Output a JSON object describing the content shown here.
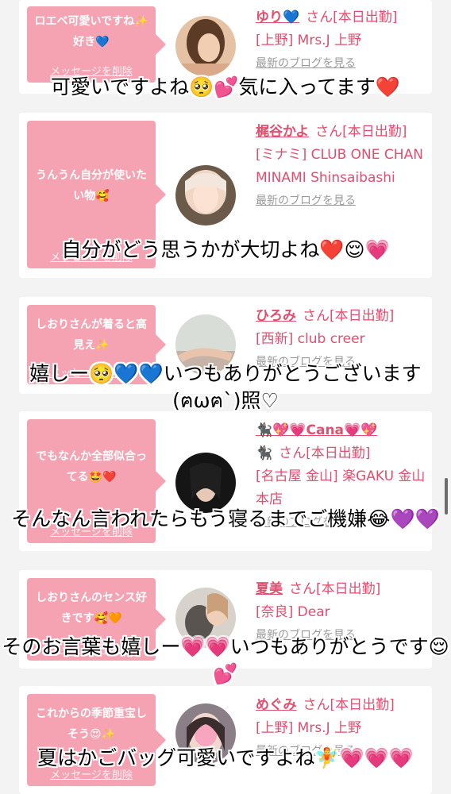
{
  "cards": [
    {
      "message": "ロエベ可愛いですね✨好き💙",
      "delete": "メッセージを削除",
      "name": "ゆり💙",
      "san": "さん[本日出勤]",
      "location": "[上野] Mrs.J 上野",
      "blog": "最新のブログを見る",
      "caption": "可愛いですよね🥺💕気に入ってます❤️"
    },
    {
      "message": "うんうん自分が使いたい物🥰",
      "delete": "メッセージを削除",
      "name": "梶谷かよ",
      "san": "さん[本日出勤]",
      "location": "[ミナミ] CLUB ONE CHAN MINAMI Shinsaibashi",
      "blog": "最新のブログを見る",
      "caption": "自分がどう思うかが大切よね❤️😌💗"
    },
    {
      "message": "しおりさんが着ると高見え✨",
      "delete": "メッセージを削除",
      "name": "ひろみ",
      "san": "さん[本日出勤]",
      "location": "[西新] club creer",
      "blog": "最新のブログを見る",
      "caption": "嬉しー🥺💙💙いつもありがとうございます(ฅωฅ`)照♡"
    },
    {
      "message": "でもなんか全部似合ってる🤩❤️",
      "delete": "メッセージを削除",
      "name": "🐈‍⬛💖💗Cana💗💖",
      "name2": "🐈‍⬛",
      "san": "さん[本日出勤]",
      "location": "[名古屋 金山] 楽GAKU 金山本店",
      "blog": "最新のブログを見る",
      "caption": "そんなん言われたらもう寝るまでご機嫌😂💜💜"
    },
    {
      "message": "しおりさんのセンス好きです🥰🧡",
      "delete": "メッセージを削除",
      "name": "夏美",
      "san": "さん[本日出勤]",
      "location": "[奈良] Dear",
      "blog": "最新のブログを見る",
      "caption": "そのお言葉も嬉しー💗💗いつもありがとうです😌💕"
    },
    {
      "message": "これからの季節重宝しそう😍✨",
      "delete": "メッセージを削除",
      "name": "めぐみ",
      "san": "さん[本日出勤]",
      "location": "[上野] Mrs.J 上野",
      "blog": "最新のブログを見る",
      "caption": "夏はかごバッグ可愛いですよね🧚💗💗💗"
    }
  ]
}
